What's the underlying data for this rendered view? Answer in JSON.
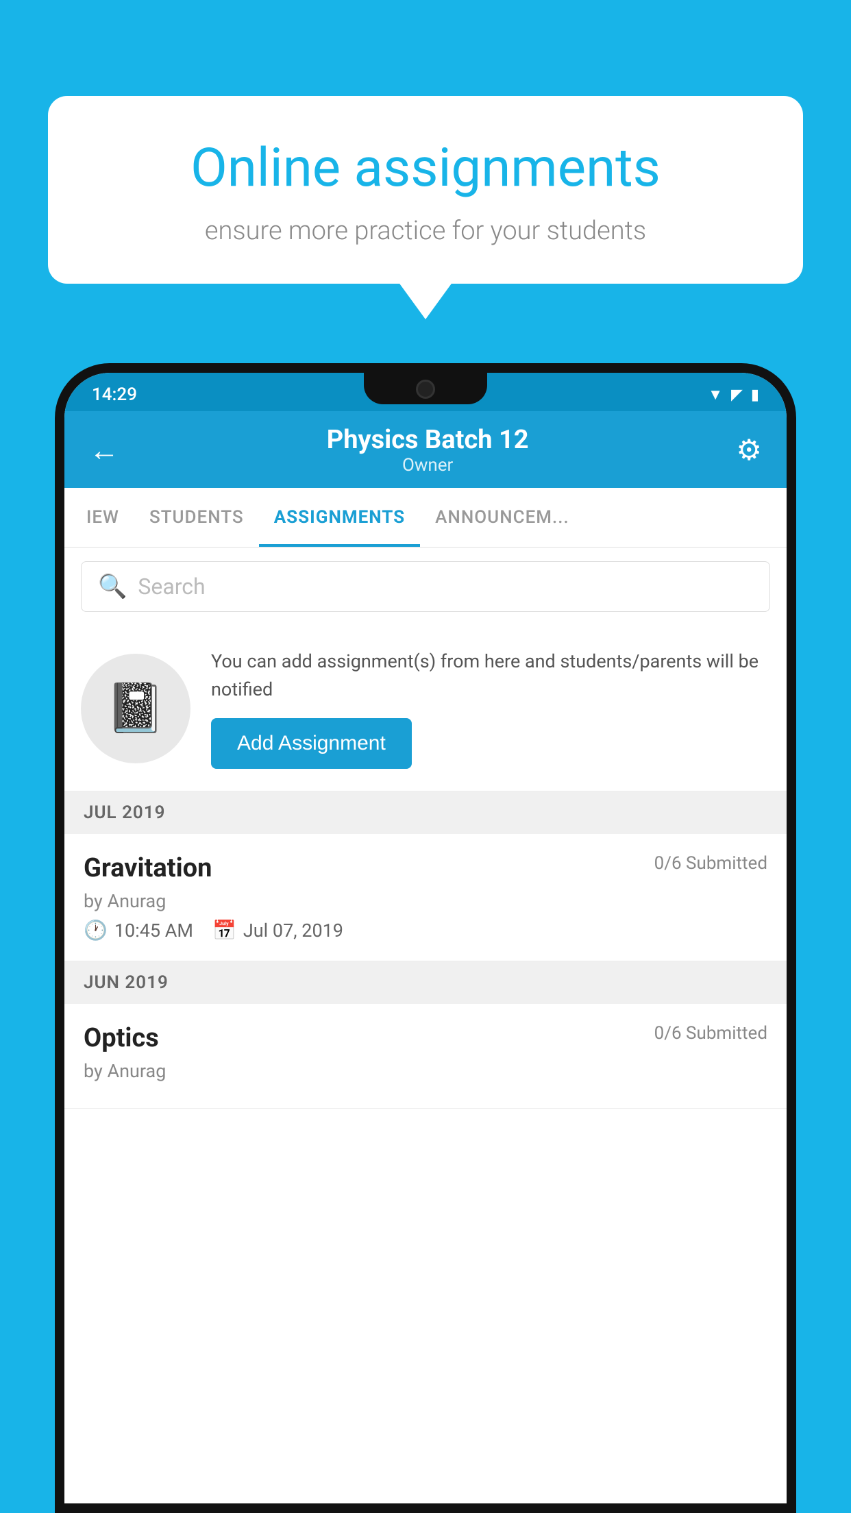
{
  "background_color": "#18b4e8",
  "speech_bubble": {
    "title": "Online assignments",
    "subtitle": "ensure more practice for your students"
  },
  "status_bar": {
    "time": "14:29",
    "icons": [
      "wifi",
      "signal",
      "battery"
    ]
  },
  "header": {
    "title": "Physics Batch 12",
    "subtitle": "Owner",
    "back_label": "←",
    "settings_label": "⚙"
  },
  "tabs": [
    {
      "label": "IEW",
      "active": false
    },
    {
      "label": "STUDENTS",
      "active": false
    },
    {
      "label": "ASSIGNMENTS",
      "active": true
    },
    {
      "label": "ANNOUNCEM...",
      "active": false
    }
  ],
  "search": {
    "placeholder": "Search"
  },
  "promo": {
    "text": "You can add assignment(s) from here and students/parents will be notified",
    "button_label": "Add Assignment"
  },
  "sections": [
    {
      "label": "JUL 2019",
      "assignments": [
        {
          "title": "Gravitation",
          "submitted": "0/6 Submitted",
          "by": "by Anurag",
          "time": "10:45 AM",
          "date": "Jul 07, 2019"
        }
      ]
    },
    {
      "label": "JUN 2019",
      "assignments": [
        {
          "title": "Optics",
          "submitted": "0/6 Submitted",
          "by": "by Anurag",
          "time": "",
          "date": ""
        }
      ]
    }
  ]
}
